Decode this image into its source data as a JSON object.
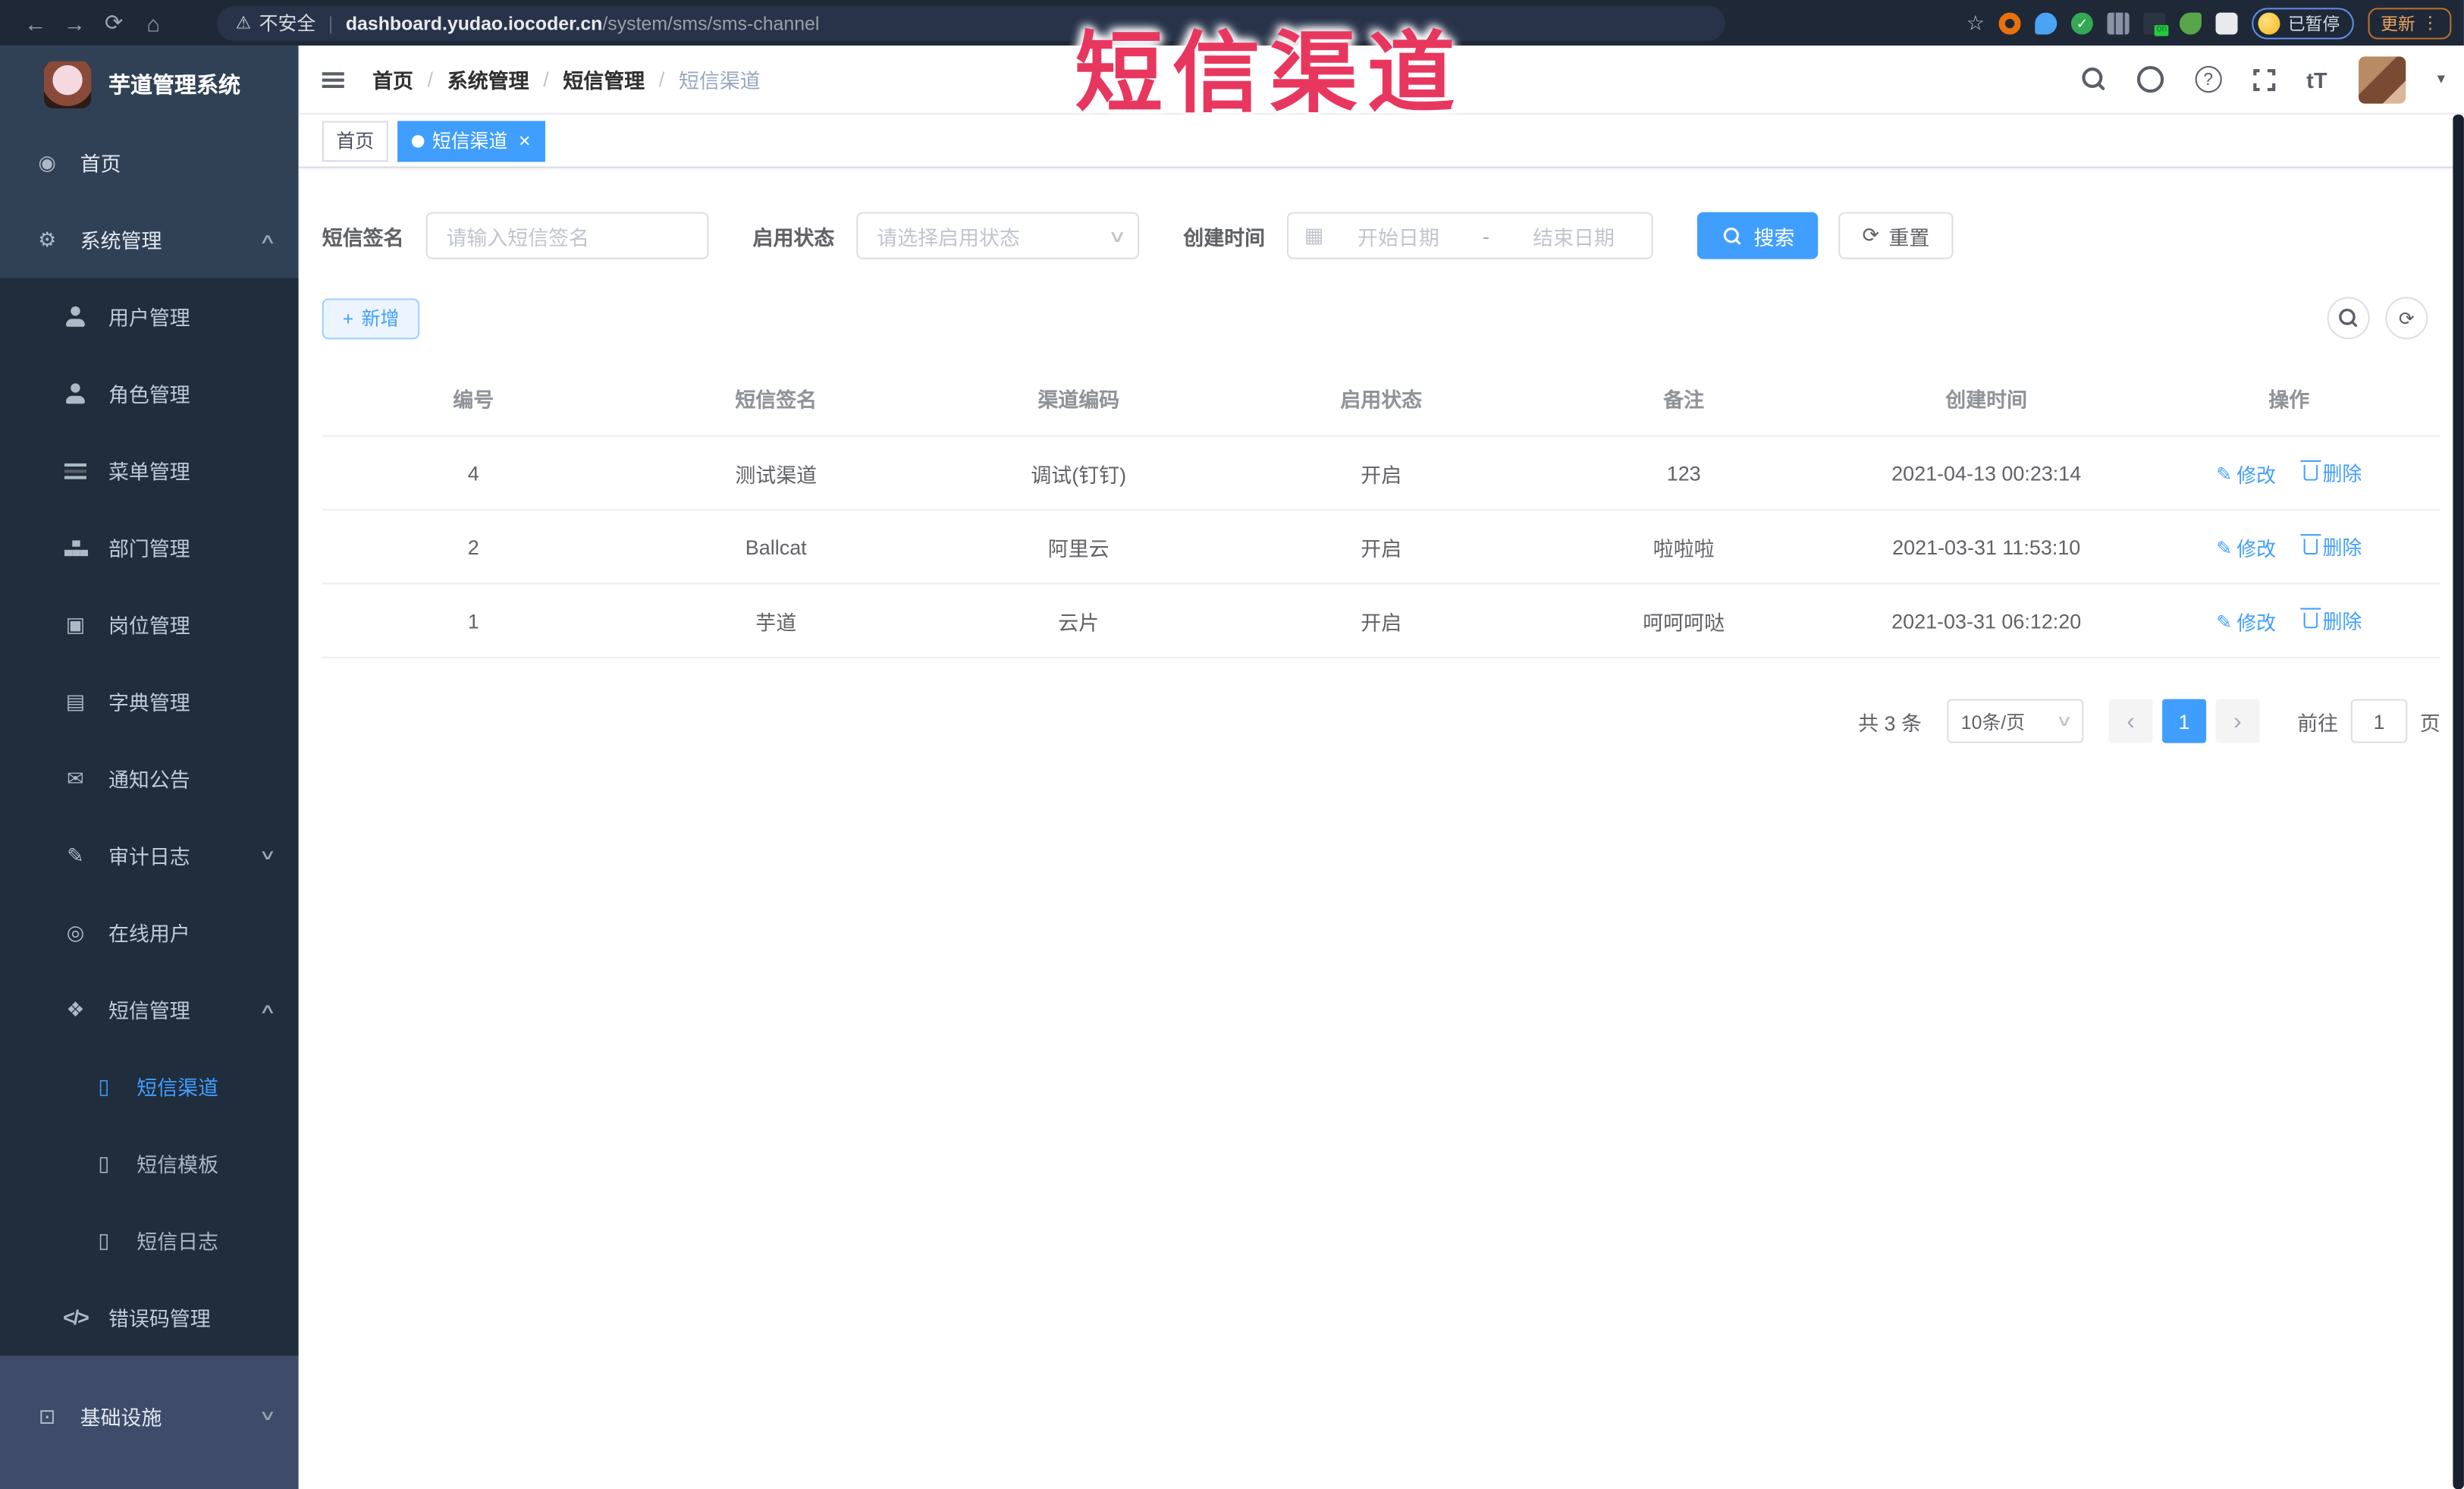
{
  "browser": {
    "security_label": "不安全",
    "url_domain": "dashboard.yudao.iocoder.cn",
    "url_path": "/system/sms/sms-channel",
    "paused_badge_label": "已暂停",
    "update_button_label": "更新"
  },
  "annotation": {
    "title": "短信渠道",
    "color": "#e8375f"
  },
  "sidebar": {
    "logo_title": "芋道管理系统",
    "items": [
      {
        "label": "首页"
      },
      {
        "label": "系统管理"
      },
      {
        "label": "用户管理"
      },
      {
        "label": "角色管理"
      },
      {
        "label": "菜单管理"
      },
      {
        "label": "部门管理"
      },
      {
        "label": "岗位管理"
      },
      {
        "label": "字典管理"
      },
      {
        "label": "通知公告"
      },
      {
        "label": "审计日志"
      },
      {
        "label": "在线用户"
      },
      {
        "label": "短信管理"
      },
      {
        "label": "短信渠道",
        "active": true
      },
      {
        "label": "短信模板"
      },
      {
        "label": "短信日志"
      },
      {
        "label": "错误码管理"
      },
      {
        "label": "基础设施"
      }
    ]
  },
  "navbar": {
    "breadcrumb": [
      {
        "label": "首页"
      },
      {
        "label": "系统管理"
      },
      {
        "label": "短信管理"
      },
      {
        "label": "短信渠道"
      }
    ],
    "separator": "/"
  },
  "tabs": [
    {
      "label": "首页",
      "active": false
    },
    {
      "label": "短信渠道",
      "active": true
    }
  ],
  "filters": {
    "sign_label": "短信签名",
    "sign_placeholder": "请输入短信签名",
    "status_label": "启用状态",
    "status_placeholder": "请选择启用状态",
    "date_label": "创建时间",
    "date_start_placeholder": "开始日期",
    "date_separator": "-",
    "date_end_placeholder": "结束日期",
    "search_label": "搜索",
    "reset_label": "重置"
  },
  "toolbar": {
    "add_label": "新增"
  },
  "table": {
    "columns": [
      "编号",
      "短信签名",
      "渠道编码",
      "启用状态",
      "备注",
      "创建时间",
      "操作"
    ],
    "rows": [
      {
        "id": "4",
        "sign": "测试渠道",
        "code": "调试(钉钉)",
        "status": "开启",
        "remark": "123",
        "created": "2021-04-13 00:23:14"
      },
      {
        "id": "2",
        "sign": "Ballcat",
        "code": "阿里云",
        "status": "开启",
        "remark": "啦啦啦",
        "created": "2021-03-31 11:53:10"
      },
      {
        "id": "1",
        "sign": "芋道",
        "code": "云片",
        "status": "开启",
        "remark": "呵呵呵哒",
        "created": "2021-03-31 06:12:20"
      }
    ],
    "edit_label": "修改",
    "delete_label": "删除"
  },
  "pagination": {
    "total_label": "共 3 条",
    "page_size_label": "10条/页",
    "current_page": "1",
    "goto_label": "前往",
    "goto_value": "1",
    "page_unit_label": "页"
  },
  "icons": {
    "back": "←",
    "forward": "→",
    "reload": "⟳",
    "home": "⌂",
    "warning": "⚠",
    "star": "☆",
    "menu_dots": "⋮",
    "caret_down": "▾",
    "dashboard": "◉",
    "gear": "⚙",
    "dict": "▤",
    "post": "▣",
    "notice": "✉",
    "log": "✎",
    "online": "◎",
    "sms": "❖",
    "phone": "▯",
    "code": "</>",
    "monitor": "⊡",
    "chevron_up": "∧",
    "chevron_down": "∨",
    "calendar": "▦",
    "plus": "+",
    "refresh": "⟳",
    "edit": "✎",
    "dot_check": "✓",
    "close": "×",
    "prev": "‹",
    "next": "›",
    "select_caret": "∨",
    "question": "?",
    "fontsize": "tT"
  },
  "colors": {
    "accent": "#409eff",
    "annotation_red": "#e8375f",
    "sidebar_bg": "#304156",
    "submenu_bg": "#1f2d3d",
    "infra_bg": "#3e4c6a",
    "browser_bar_bg": "#1f2837",
    "add_button_bg": "#ecf5ff",
    "table_border": "#ebeef5"
  }
}
